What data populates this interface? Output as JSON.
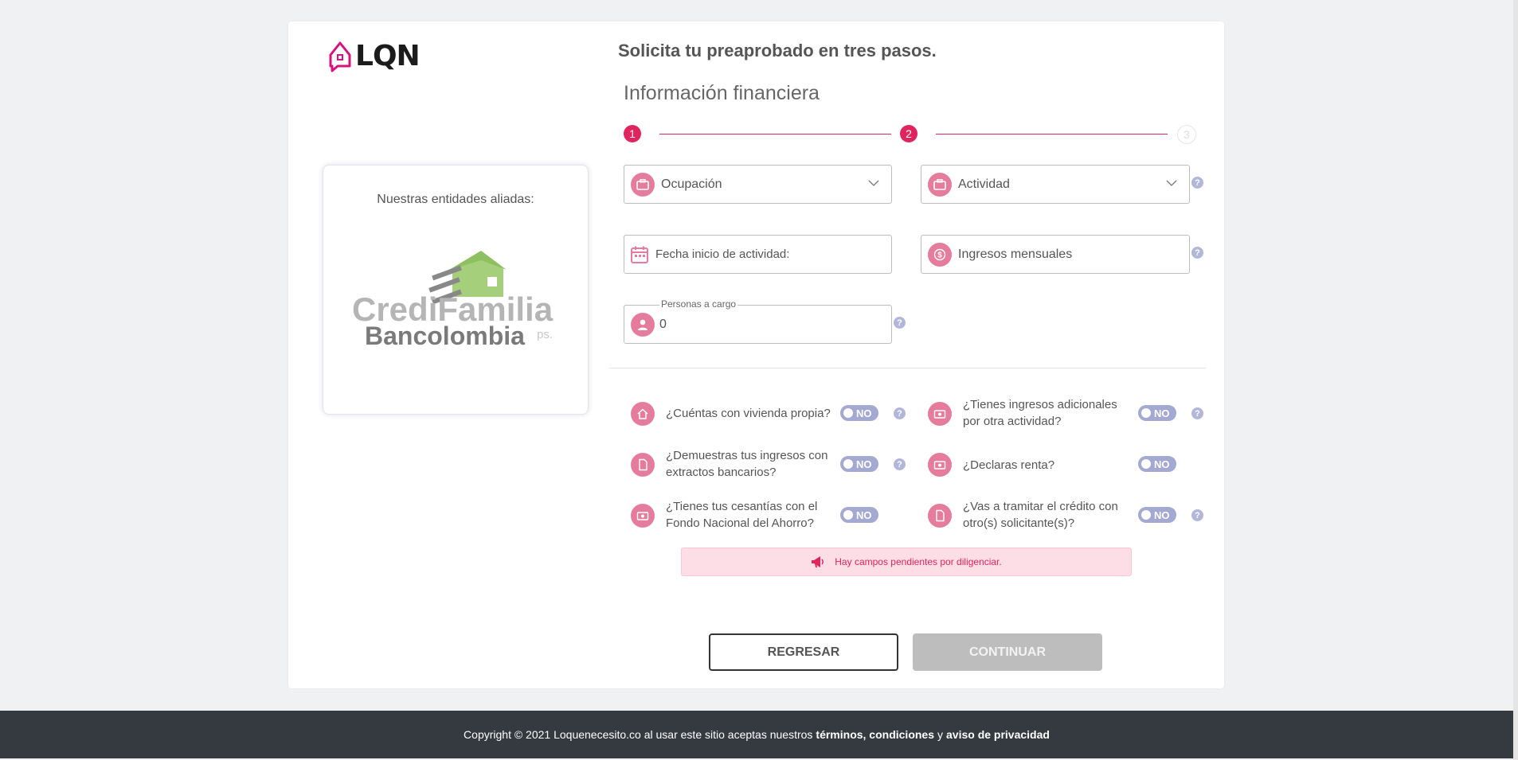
{
  "brand": {
    "name": "LQN"
  },
  "headline": "Solicita tu preaprobado en tres pasos.",
  "section_title": "Información financiera",
  "stepper": {
    "steps": [
      "1",
      "2",
      "3"
    ],
    "current": 2
  },
  "partners": {
    "title": "Nuestras entidades aliadas:",
    "logo_top": "CrediFamilia",
    "logo_bottom": "Bancolombia",
    "logo_suffix": "ps."
  },
  "fields": {
    "ocupacion": {
      "label": "Ocupación",
      "icon": "briefcase-icon"
    },
    "actividad": {
      "label": "Actividad",
      "icon": "briefcase-icon"
    },
    "fecha_inicio": {
      "label": "Fecha inicio de actividad:",
      "icon": "calendar-icon"
    },
    "ingresos": {
      "label": "Ingresos mensuales",
      "icon": "dollar-icon"
    },
    "personas": {
      "float_label": "Personas a cargo",
      "value": "0",
      "icon": "user-icon"
    }
  },
  "help_glyph": "?",
  "questions": [
    {
      "text": "¿Cuéntas con vivienda propia?",
      "toggle": "NO",
      "icon": "house-icon"
    },
    {
      "text": "¿Tienes ingresos adicionales por otra actividad?",
      "toggle": "NO",
      "icon": "money-icon"
    },
    {
      "text": "¿Demuestras tus ingresos con extractos bancarios?",
      "toggle": "NO",
      "icon": "document-icon"
    },
    {
      "text": "¿Declaras renta?",
      "toggle": "NO",
      "icon": "money-icon"
    },
    {
      "text": "¿Tienes tus cesantías con el Fondo Nacional del Ahorro?",
      "toggle": "NO",
      "icon": "money-icon"
    },
    {
      "text": "¿Vas a tramitar el crédito con otro(s) solicitante(s)?",
      "toggle": "NO",
      "icon": "document-icon"
    }
  ],
  "alert": {
    "text": "Hay campos pendientes por diligenciar.",
    "icon": "megaphone-icon"
  },
  "buttons": {
    "back": "REGRESAR",
    "next": "CONTINUAR"
  },
  "footer": {
    "prefix": "Copyright © 2021 Loquenecesito.co al usar este sitio aceptas nuestros",
    "terms": "términos, condiciones",
    "and": "y",
    "privacy": "aviso de privacidad"
  },
  "colors": {
    "accent": "#e0245e",
    "icon_bg": "#e57b9d",
    "toggle": "#a4a9d2",
    "footer": "#343a40"
  }
}
